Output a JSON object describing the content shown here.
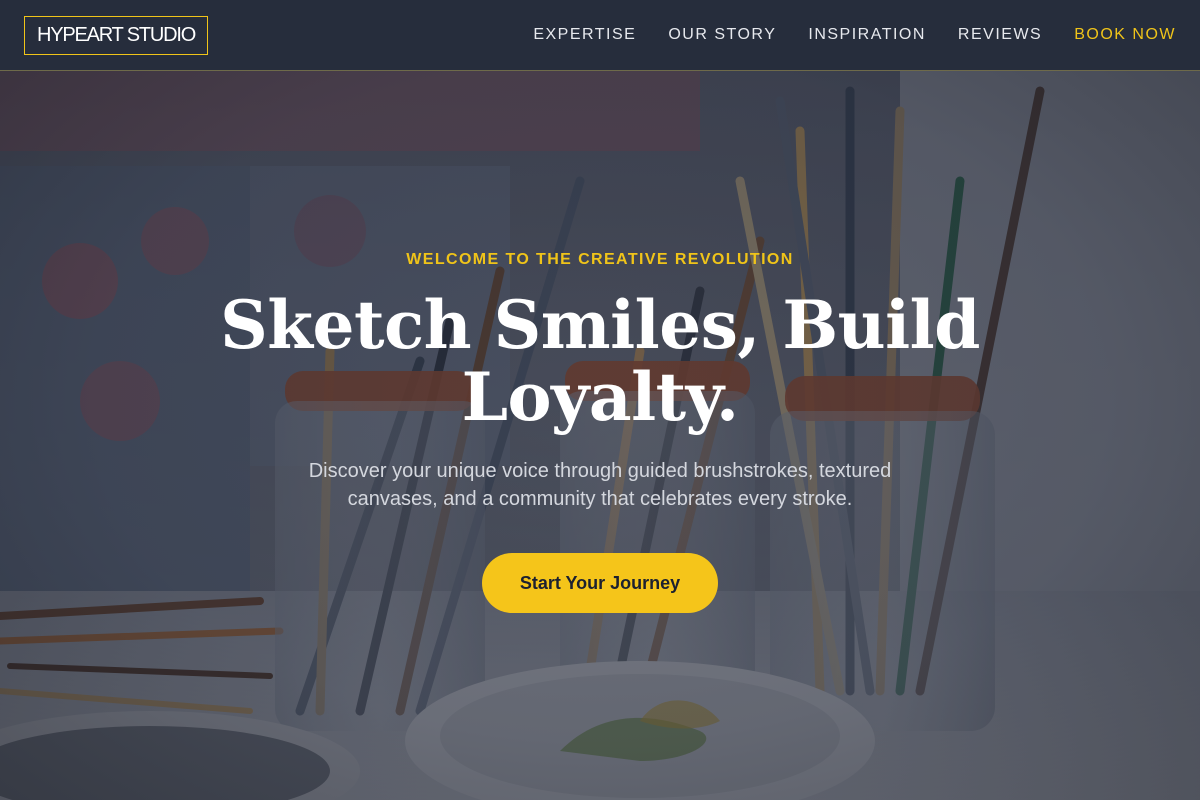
{
  "brand": {
    "logo_text": "HYPEART STUDIO"
  },
  "nav": {
    "items": [
      {
        "label": "EXPERTISE"
      },
      {
        "label": "OUR STORY"
      },
      {
        "label": "INSPIRATION"
      },
      {
        "label": "REVIEWS"
      }
    ],
    "cta_label": "BOOK NOW"
  },
  "hero": {
    "eyebrow": "WELCOME TO THE CREATIVE REVOLUTION",
    "headline": "Sketch Smiles, Build Loyalty.",
    "subtext": "Discover your unique voice through guided brushstrokes, textured canvases, and a community that celebrates every stroke.",
    "button_label": "Start Your Journey",
    "background_subject": "paint-brushes-in-jars-photo"
  },
  "colors": {
    "accent": "#f0c419",
    "header_bg": "#262d3c",
    "button_bg": "#f5c51a",
    "button_text": "#1c2130"
  }
}
